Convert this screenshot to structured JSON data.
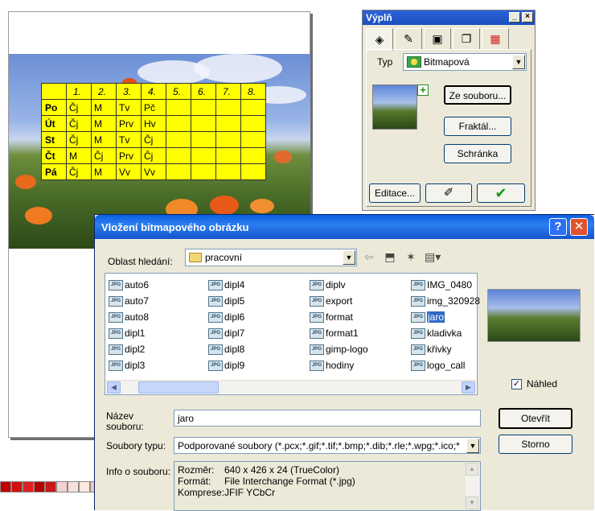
{
  "timetable": {
    "header": [
      "1.",
      "2.",
      "3.",
      "4.",
      "5.",
      "6.",
      "7.",
      "8."
    ],
    "rows": [
      {
        "day": "Po",
        "cells": [
          "Čj",
          "M",
          "Tv",
          "Pč",
          "",
          "",
          "",
          ""
        ]
      },
      {
        "day": "Út",
        "cells": [
          "Čj",
          "M",
          "Prv",
          "Hv",
          "",
          "",
          "",
          ""
        ]
      },
      {
        "day": "St",
        "cells": [
          "Čj",
          "M",
          "Tv",
          "Čj",
          "",
          "",
          "",
          ""
        ]
      },
      {
        "day": "Čt",
        "cells": [
          "M",
          "Čj",
          "Prv",
          "Čj",
          "",
          "",
          "",
          ""
        ]
      },
      {
        "day": "Pá",
        "cells": [
          "Čj",
          "M",
          "Vv",
          "Vv",
          "",
          "",
          "",
          ""
        ]
      }
    ]
  },
  "fill_docker": {
    "title": "Výplň",
    "type_label": "Typ",
    "type_value": "Bitmapová",
    "from_file_button": "Ze souboru...",
    "fractal_button": "Fraktál...",
    "clipboard_button": "Schránka",
    "edit_button": "Editace...",
    "minimize_glyph": "_",
    "close_glyph": "×",
    "plus_glyph": "+",
    "tab_icons": [
      "fill-bucket-icon",
      "pen-icon",
      "bitmap-frame-icon",
      "shadow-icon",
      "color-palette-icon"
    ]
  },
  "dialog": {
    "title": "Vložení bitmapového obrázku",
    "help_glyph": "?",
    "close_glyph": "✕",
    "look_in_label": "Oblast hledání:",
    "look_in_value": "pracovní",
    "files": [
      [
        "auto6",
        "auto7",
        "auto8",
        "dipl1",
        "dipl2",
        "dipl3"
      ],
      [
        "dipl4",
        "dipl5",
        "dipl6",
        "dipl7",
        "dipl8",
        "dipl9"
      ],
      [
        "diplv",
        "export",
        "format",
        "format1",
        "gimp-logo",
        "hodiny"
      ],
      [
        "IMG_0480",
        "img_320928",
        "jaro",
        "kladivka",
        "křivky",
        "logo_call"
      ]
    ],
    "selected_file": "jaro",
    "jpg_badge": "JPG",
    "preview_label": "Náhled",
    "preview_checked": true,
    "filename_label": "Název souboru:",
    "filename_value": "jaro",
    "filetype_label": "Soubory typu:",
    "filetype_value": "Podporované soubory (*.pcx;*.gif;*.tif;*.bmp;*.dib;*.rle;*.wpg;*.ico;*",
    "open_button": "Otevřít",
    "cancel_button": "Storno",
    "info_label": "Info o souboru:",
    "info": [
      {
        "key": "Rozměr:",
        "value": "640 x 426 x 24 (TrueColor)"
      },
      {
        "key": "Formát:",
        "value": "File Interchange Format (*.jpg)"
      },
      {
        "key": "Komprese:",
        "value": "JFIF YCbCr"
      }
    ]
  },
  "palette_colors": [
    "#c00000",
    "#d01010",
    "#e02020",
    "#b00000",
    "#c81818",
    "#f4d0d0",
    "#f8e0d8",
    "#fce8e0",
    "#f0c8b8",
    "#e8b8a0",
    "#f2d8c0",
    "#e8c090",
    "#d8a070",
    "#c88050"
  ]
}
